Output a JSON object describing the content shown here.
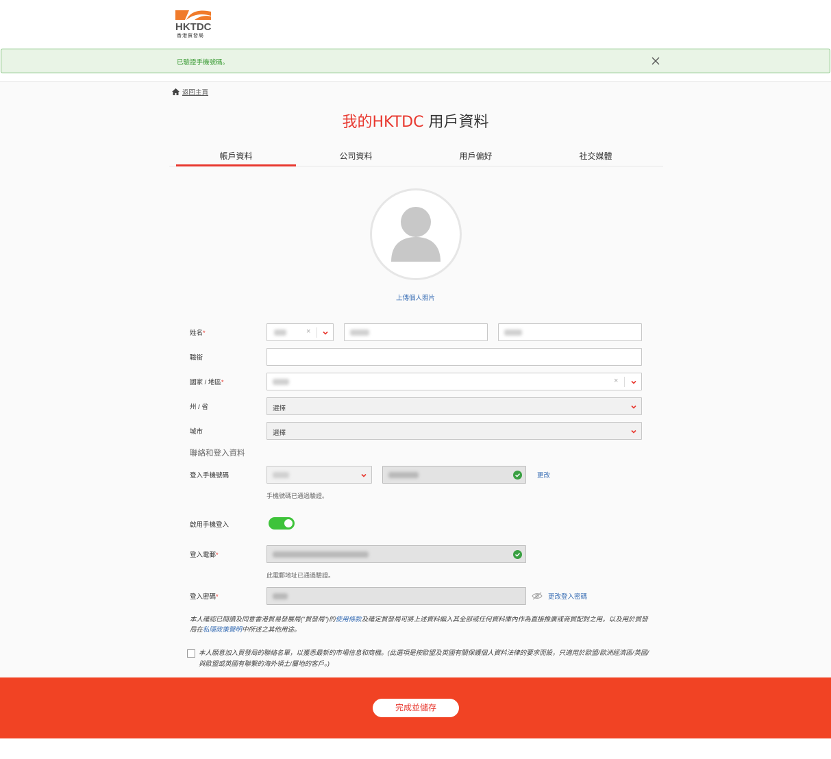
{
  "brand": {
    "logo_text": "HKTDC",
    "logo_sub": "香港貿發局",
    "accent": "#e8382f",
    "footer_color": "#f14324"
  },
  "alert": {
    "message": "已驗證手機號碼。"
  },
  "breadcrumb": {
    "home_label": "返回主頁"
  },
  "title": {
    "accent": "我的HKTDC",
    "rest": " 用戶資料"
  },
  "tabs": [
    {
      "label": "帳戶資料",
      "active": true
    },
    {
      "label": "公司資料",
      "active": false
    },
    {
      "label": "用戶偏好",
      "active": false
    },
    {
      "label": "社交媒體",
      "active": false
    }
  ],
  "avatar": {
    "upload_label": "上傳個人照片"
  },
  "form": {
    "name_label": "姓名",
    "title_label": "職銜",
    "country_label": "國家 / 地區",
    "state_label": "州 / 省",
    "state_value": "選擇",
    "city_label": "城市",
    "city_value": "選擇",
    "section_contact": "聯絡和登入資料",
    "mobile_label": "登入手機號碼",
    "mobile_change": "更改",
    "mobile_hint": "手機號碼已通過驗證。",
    "enable_mobile_label": "啟用手機登入",
    "email_label": "登入電郵",
    "email_hint": "此電郵地址已通過驗證。",
    "password_label": "登入密碼",
    "password_change": "更改登入密碼"
  },
  "consent": {
    "part1": "本人確認已閱讀及同意香港貿易發展局(\"貿發局\")的",
    "terms_link": "使用條款",
    "part2": "及確定貿發局可將上述資料編入其全部或任何資料庫內作為直接推廣或商貿配對之用，以及用於貿發局在",
    "privacy_link": "私隱政策聲明",
    "part3": "中所述之其他用途。",
    "optin": "本人願意加入貿發局的聯絡名單，以獲悉最新的市場信息和商機。(此選項是按歐盟及英國有關保護個人資料法律的要求而設，只適用於歐盟/歐洲經濟區/英國/ 與歐盟或英國有聯繫的海外領土/屬地的客戶。)"
  },
  "footer": {
    "save_label": "完成並儲存"
  }
}
